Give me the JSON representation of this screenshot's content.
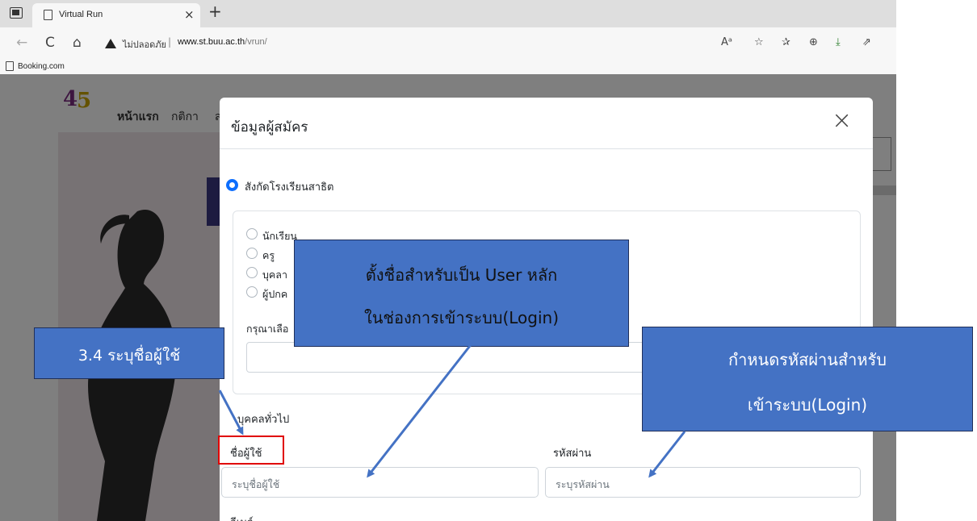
{
  "browser": {
    "tab_title": "Virtual Run",
    "tab_close": "×",
    "new_tab": "+",
    "security_label": "ไม่ปลอดภัย",
    "url_separator": "|",
    "url_domain": "www.st.buu.ac.th",
    "url_path": "/vrun/",
    "bookmark": "Booking.com",
    "tools": [
      "Aᵃ",
      "☆",
      "✰",
      "⊕",
      "⤓",
      "⇗"
    ]
  },
  "site": {
    "logo_digits": [
      "4",
      "5"
    ],
    "menu": [
      "หน้าแรก",
      "กติกา",
      "ส"
    ]
  },
  "modal": {
    "title": "ข้อมูลผู้สมัคร",
    "close": "×",
    "affiliation_option": "สังกัดโรงเรียนสาธิต",
    "school_roles": [
      "นักเรียน",
      "ครู",
      "บุคลา",
      "ผู้ปกค"
    ],
    "select_label": "กรุณาเลือ",
    "general_option": "บุคคลทั่วไป",
    "username_label": "ชื่อผู้ใช้",
    "username_placeholder": "ระบุชื่อผู้ใช้",
    "password_label": "รหัสผ่าน",
    "password_placeholder": "ระบุรหัสผ่าน",
    "email_label": "อีเมล์"
  },
  "annotations": {
    "step_label": "3.4 ระบุชื่อผู้ใช้",
    "username_note_line1": "ตั้งชื่อสำหรับเป็น User หลัก",
    "username_note_line2": "ในช่องการเข้าระบบ(Login)",
    "password_note_line1": "กำหนดรหัสผ่านสำหรับ",
    "password_note_line2": "เข้าระบบ(Login)",
    "callout_color": "#4472c4",
    "highlight_color": "#e00000"
  }
}
